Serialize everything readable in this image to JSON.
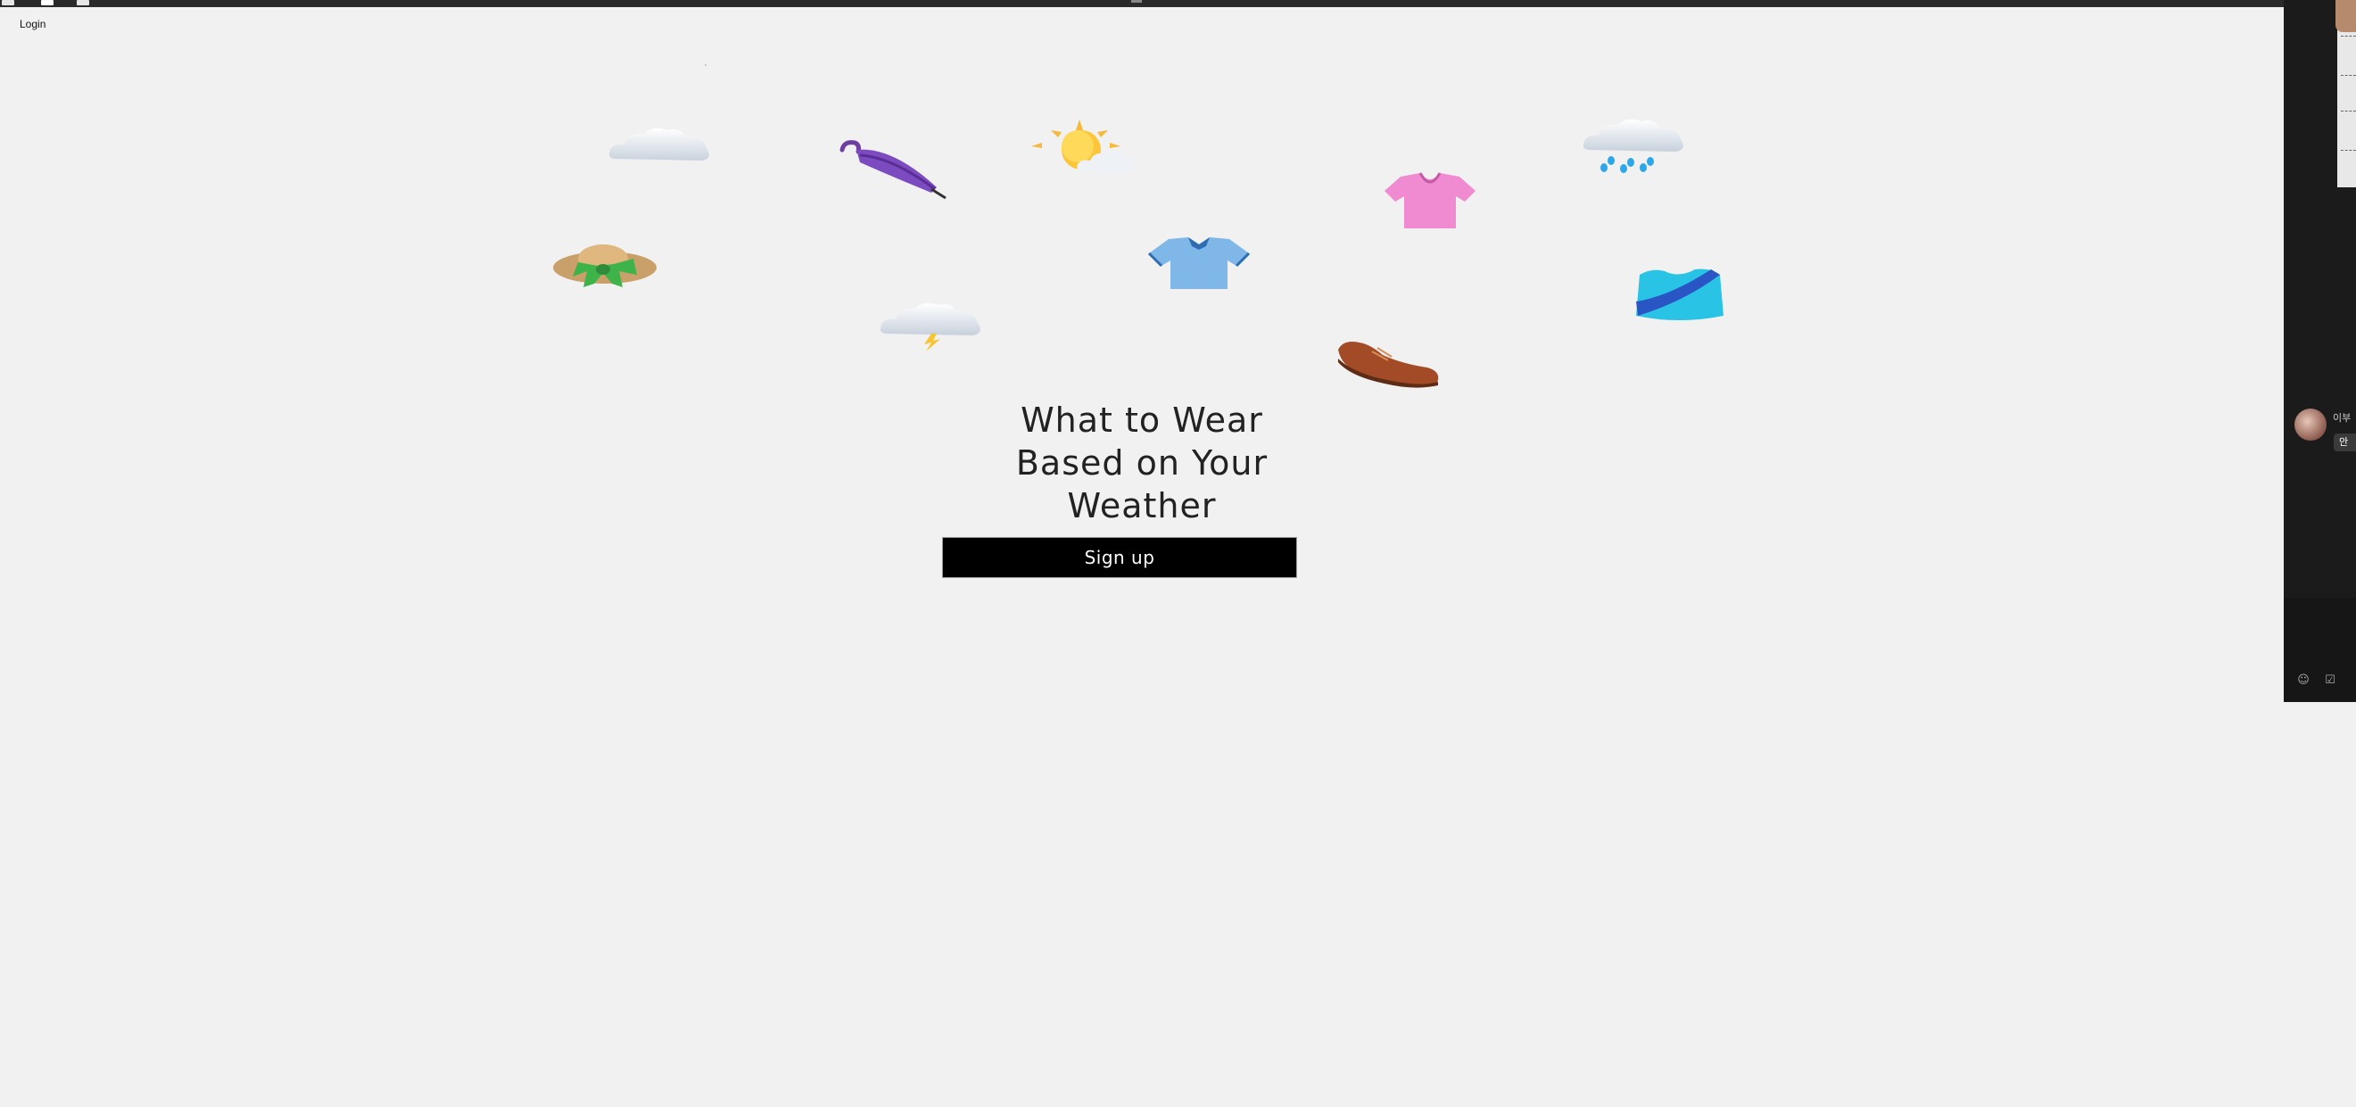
{
  "nav": {
    "login_label": "Login"
  },
  "hero": {
    "headline_lines": [
      "What to Wear",
      "Based on Your",
      "Weather"
    ],
    "signup_label": "Sign up"
  },
  "icons": [
    "cloud-icon",
    "umbrella-icon",
    "sun-behind-cloud-icon",
    "cloud-with-rain-icon",
    "blouse-icon",
    "hat-icon",
    "polo-shirt-icon",
    "swimsuit-icon",
    "cloud-with-lightning-icon",
    "shoe-icon"
  ],
  "chat_panel": {
    "sender_name": "이부",
    "message_preview": "안"
  }
}
